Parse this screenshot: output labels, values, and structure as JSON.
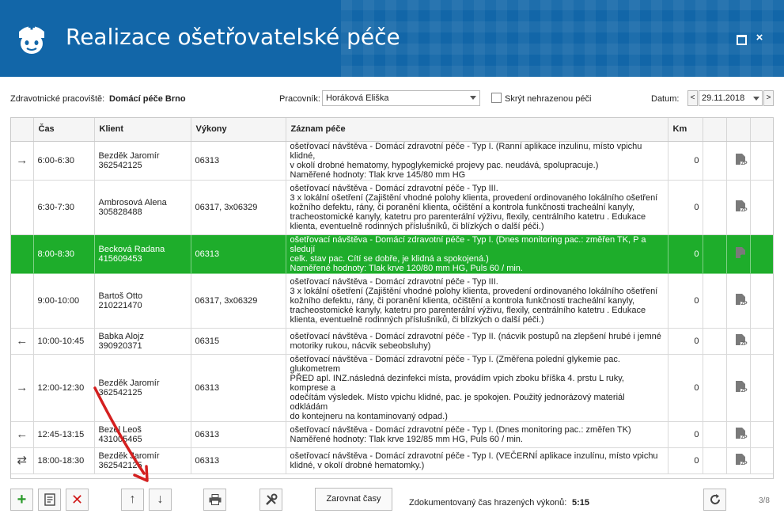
{
  "window": {
    "title": "Realizace ošetřovatelské péče",
    "max_icon": "maximize-icon",
    "close_glyph": "×"
  },
  "filters": {
    "workplace_label": "Zdravotnické pracoviště:",
    "workplace_value": "Domácí péče Brno",
    "worker_label": "Pracovník:",
    "worker_value": "Horáková Eliška",
    "hide_label": "Skrýt nehrazenou péči",
    "date_label": "Datum:",
    "date_prev": "<",
    "date_value": "29.11.2018",
    "date_next": ">"
  },
  "table": {
    "columns": [
      "",
      "Čas",
      "Klient",
      "Výkony",
      "Záznam péče",
      "Km",
      "",
      "",
      ""
    ],
    "rows": [
      {
        "arrow": "→",
        "time": "6:00-6:30",
        "client": "Bezděk Jaromír",
        "id": "362542125",
        "codes": "06313",
        "record": [
          "ošetřovací návštěva - Domácí zdravotní péče - Typ I. (Ranní aplikace  inzulinu,  místo vpichu klidné,",
          "v okolí drobné hematomy, hypoglykemické projevy pac. neudává, spolupracuje.)",
          "Naměřené hodnoty: Tlak krve 145/80 mm HG"
        ],
        "km": "0",
        "icon": "document-zp-icon"
      },
      {
        "arrow": "",
        "time": "6:30-7:30",
        "client": "Ambrosová Alena",
        "id": "305828488",
        "codes": "06317, 3x06329",
        "record": [
          "ošetřovací návštěva - Domácí zdravotní péče - Typ III.",
          "3 x lokální ošetření (Zajištění vhodné polohy klienta, provedení ordinovaného lokálního ošetření",
          "kožního defektu, rány, či poranění klienta, očištění a kontrola funkčnosti tracheální kanyly,",
          "tracheostomické kanyly, katetru pro parenterální výživu, flexily, centrálního katetru . Edukace",
          "klienta, eventuelně rodinných příslušníků, či blízkých o další péči.)"
        ],
        "km": "0",
        "icon": "document-zp-icon"
      },
      {
        "arrow": "",
        "time": "8:00-8:30",
        "client": "Becková Radana",
        "id": "415609453",
        "codes": "06313",
        "record": [
          "ošetřovací návštěva - Domácí zdravotní péče - Typ I. (Dnes monitoring pac.: změřen TK, P a sledují",
          "celk. stav pac. Cítí se dobře, je klidná a spokojená.)",
          "Naměřené hodnoty: Tlak krve 120/80 mm HG, Puls 60 / min."
        ],
        "km": "0",
        "icon": "document-zp-icon",
        "selected": true
      },
      {
        "arrow": "",
        "time": "9:00-10:00",
        "client": "Bartoš Otto",
        "id": "210221470",
        "codes": "06317, 3x06329",
        "record": [
          "ošetřovací návštěva - Domácí zdravotní péče - Typ III.",
          "3 x lokální ošetření (Zajištění vhodné polohy klienta, provedení ordinovaného lokálního ošetření",
          "kožního defektu, rány, či poranění klienta, očištění a kontrola funkčnosti tracheální kanyly,",
          "tracheostomické kanyly, katetru pro parenterální výživu, flexily, centrálního katetru . Edukace",
          "klienta, eventuelně rodinných příslušníků, či blízkých o další péči.)"
        ],
        "km": "0",
        "icon": "document-zp-icon"
      },
      {
        "arrow": "←",
        "time": "10:00-10:45",
        "client": "Babka Alojz",
        "id": "390920371",
        "codes": "06315",
        "record": [
          "ošetřovací návštěva - Domácí zdravotní péče - Typ II. (nácvik postupů na zlepšení hrubé i jemné",
          "motoriky rukou, nácvik sebeobsluhy)"
        ],
        "km": "0",
        "icon": "document-zp-icon"
      },
      {
        "arrow": "→",
        "time": "12:00-12:30",
        "client": "Bezděk Jaromír",
        "id": "362542125",
        "codes": "06313",
        "record": [
          "ošetřovací návštěva - Domácí zdravotní péče - Typ I. (Změřena polední glykemie pac. glukometrem",
          "PŘED apl. INZ.následná dezinfekci místa, provádím vpich zboku bříška 4. prstu L ruky, komprese a",
          "odečítám výsledek. Místo vpichu klidné, pac. je spokojen. Použitý jednorázový materiál odkládám",
          "do kontejneru na kontaminovaný odpad.)"
        ],
        "km": "0",
        "icon": "document-zp-icon"
      },
      {
        "arrow": "←",
        "time": "12:45-13:15",
        "client": "Bezel Leoš",
        "id": "431005465",
        "codes": "06313",
        "record": [
          "ošetřovací návštěva - Domácí zdravotní péče - Typ I. (Dnes monitoring pac.: změřen TK)",
          "Naměřené hodnoty: Tlak krve 192/85 mm HG, Puls 60 / min."
        ],
        "km": "0",
        "icon": "document-zp-icon"
      },
      {
        "arrow": "⇄",
        "time": "18:00-18:30",
        "client": "Bezděk Jaromír",
        "id": "362542125",
        "codes": "06313",
        "record": [
          "ošetřovací návštěva - Domácí zdravotní péče - Typ I. (VEČERNÍ aplikace inzulínu, místo vpichu",
          "klidné, v okolí drobné hematomky.)"
        ],
        "km": "0",
        "icon": "document-zp-icon"
      }
    ],
    "doc_badge": "ZP"
  },
  "toolbar": {
    "add_icon": "plus-icon",
    "edit_icon": "edit-document-icon",
    "delete_icon": "delete-x-icon",
    "up_icon": "arrow-up-icon",
    "down_icon": "arrow-down-icon",
    "print_icon": "printer-icon",
    "tools_icon": "tools-icon",
    "align_label": "Zarovnat časy",
    "summary_label": "Zdokumentovaný čas hrazených výkonů:",
    "summary_value": "5:15",
    "refresh_icon": "refresh-icon",
    "page_counter": "3/8"
  },
  "colors": {
    "titlebar": "#1266a8",
    "selected_row": "#1ead2b",
    "annotation_arrow": "#d42020"
  }
}
